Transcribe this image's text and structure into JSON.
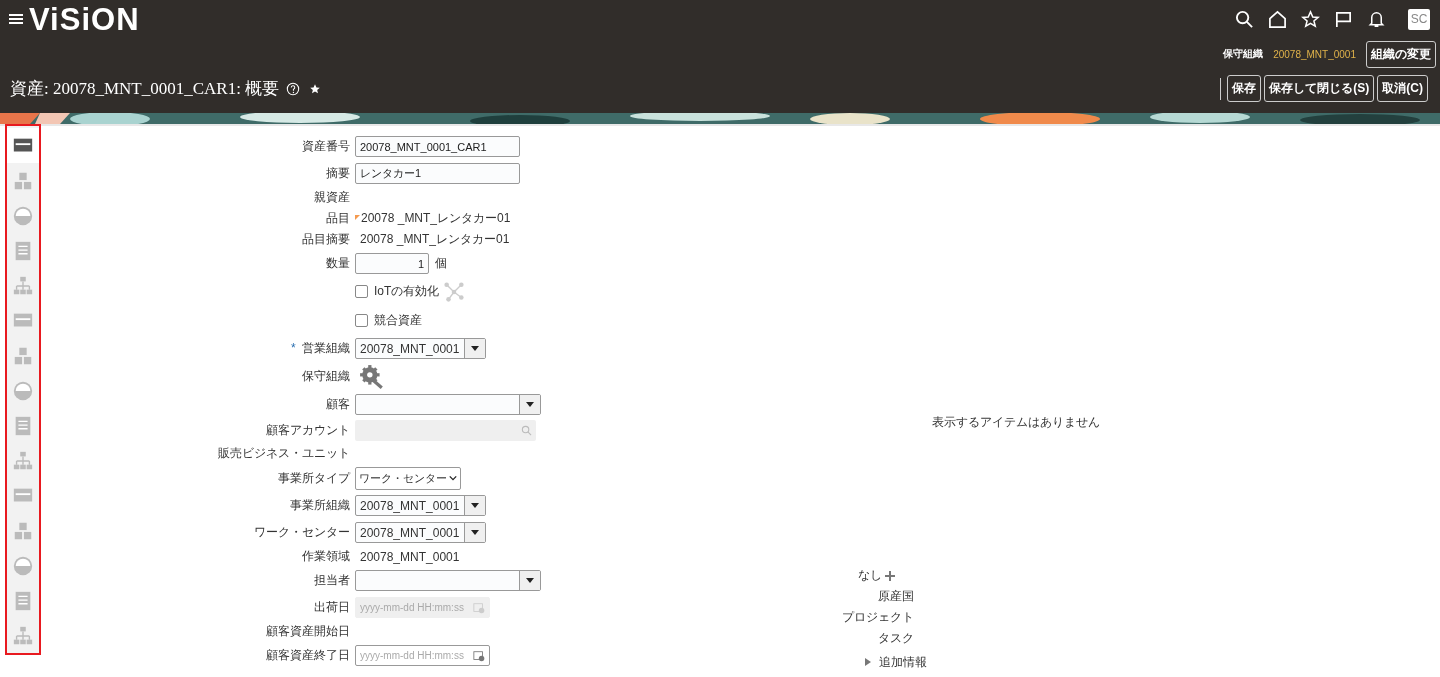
{
  "header": {
    "logo": "ViSiON",
    "avatar": "SC",
    "org_label": "保守組織",
    "org_value": "20078_MNT_0001",
    "change_org": "組織の変更",
    "title": "資産: 20078_MNT_0001_CAR1: 概要",
    "buttons": [
      "保存",
      "保存して閉じる(S)",
      "取消(C)"
    ]
  },
  "sidebar": {
    "highlighted": true,
    "items": [
      {
        "selected": true
      },
      {
        "selected": false
      },
      {
        "selected": false
      },
      {
        "selected": false
      },
      {
        "selected": false
      },
      {
        "selected": false
      },
      {
        "selected": false
      },
      {
        "selected": false
      },
      {
        "selected": false
      },
      {
        "selected": false
      },
      {
        "selected": false
      },
      {
        "selected": false
      },
      {
        "selected": false
      },
      {
        "selected": false
      },
      {
        "selected": false
      }
    ]
  },
  "form": [
    {
      "kind": "input",
      "label": "資産番号",
      "value": "20078_MNT_0001_CAR1"
    },
    {
      "kind": "input",
      "label": "摘要",
      "value": "レンタカー1"
    },
    {
      "kind": "text",
      "label": "親資産"
    },
    {
      "kind": "text",
      "label": "品目",
      "value": "20078 _MNT_レンタカー01",
      "flagged": true
    },
    {
      "kind": "text",
      "label": "品目摘要",
      "value": "20078 _MNT_レンタカー01",
      "flagged": false
    },
    {
      "kind": "number",
      "label": "数量",
      "value": "1",
      "unit": "個"
    },
    {
      "kind": "checkbox",
      "text": "IoTの有効化",
      "checked": false,
      "icon": true
    },
    {
      "kind": "checkbox",
      "text": "競合資産",
      "checked": false,
      "icon": false
    },
    {
      "kind": "select",
      "label": "営業組織",
      "value": "20078_MNT_0001",
      "required_mark": "*",
      "wide": false
    },
    {
      "kind": "icon",
      "label": "保守組織"
    },
    {
      "kind": "select",
      "label": "顧客",
      "wide": true
    },
    {
      "kind": "search",
      "label": "顧客アカウント",
      "disabled": true
    },
    {
      "kind": "text",
      "label": "販売ビジネス・ユニット"
    },
    {
      "kind": "choice",
      "label": "事業所タイプ",
      "value": "ワーク・センター"
    },
    {
      "kind": "select",
      "label": "事業所組織",
      "value": "20078_MNT_0001",
      "wide": false
    },
    {
      "kind": "select",
      "label": "ワーク・センター",
      "value": "20078_MNT_0001",
      "wide": false
    },
    {
      "kind": "text",
      "label": "作業領域",
      "value": "20078_MNT_0001"
    },
    {
      "kind": "select",
      "label": "担当者",
      "wide": true
    },
    {
      "kind": "date",
      "label": "出荷日",
      "placeholder": "yyyy-mm-dd HH:mm:ss",
      "disabled": true
    },
    {
      "kind": "text",
      "label": "顧客資産開始日"
    },
    {
      "kind": "date",
      "label": "顧客資産終了日",
      "placeholder": "yyyy-mm-dd HH:mm:ss",
      "disabled": false
    }
  ],
  "right": {
    "empty_message": "表示するアイテムはありません",
    "none_text": "なし",
    "fields": [
      "原産国",
      "プロジェクト",
      "タスク"
    ],
    "section": {
      "label": "追加情報",
      "expanded": false
    }
  }
}
